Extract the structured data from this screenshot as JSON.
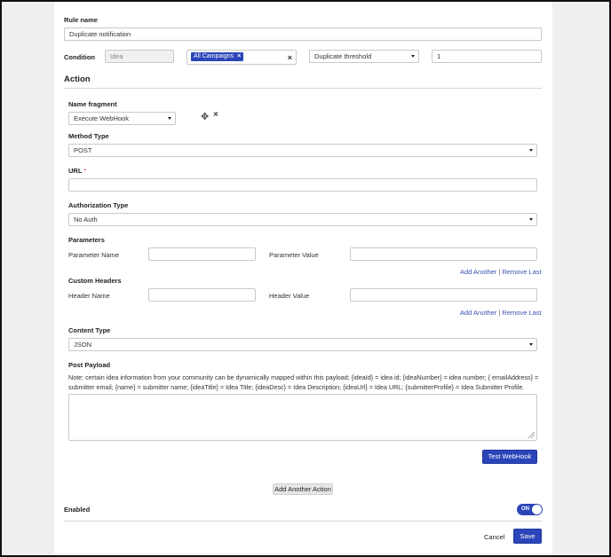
{
  "rule": {
    "name_label": "Rule name",
    "name_value": "Duplicate notification",
    "condition_label": "Condition",
    "condition_field_value": "Idea",
    "campaign_tag": "All Campaigns",
    "tag_remove_glyph": "×",
    "clear_glyph": "×",
    "threshold_select_value": "Duplicate threshold",
    "threshold_value": "1"
  },
  "action": {
    "heading": "Action",
    "name_fragment_label": "Name fragment",
    "name_fragment_value": "Execute WebHook",
    "move_glyph": "✥",
    "remove_glyph": "×",
    "method_type_label": "Method Type",
    "method_type_value": "POST",
    "url_label": "URL",
    "required_mark": "*",
    "url_value": "",
    "auth_type_label": "Authorization Type",
    "auth_type_value": "No Auth",
    "parameters_label": "Parameters",
    "parameter_name_label": "Parameter Name",
    "parameter_value_label": "Parameter Value",
    "add_another_label": "Add Another",
    "divider": "|",
    "remove_last_label": "Remove Last",
    "custom_headers_label": "Custom Headers",
    "header_name_label": "Header Name",
    "header_value_label": "Header Value",
    "content_type_label": "Content Type",
    "content_type_value": "JSON",
    "post_payload_label": "Post Payload",
    "payload_note": "Note: certain idea information from your community can be dynamically mapped within this payload; {ideaId} = idea id; {ideaNumber} = idea number; { emailAddress} = submitter email; {name} = submitter name; {ideaTitle} = Idea Title; {ideaDesc} = Idea Description; {ideaUrl} = Idea URL; {submitterProfile} = Idea Submitter Profile.",
    "test_webhook_label": "Test WebHook",
    "add_another_action_label": "Add Another Action"
  },
  "footer": {
    "enabled_label": "Enabled",
    "toggle_label": "ON",
    "cancel_label": "Cancel",
    "save_label": "Save"
  },
  "colors": {
    "accent": "#2b45b9",
    "link": "#3a52b3"
  }
}
